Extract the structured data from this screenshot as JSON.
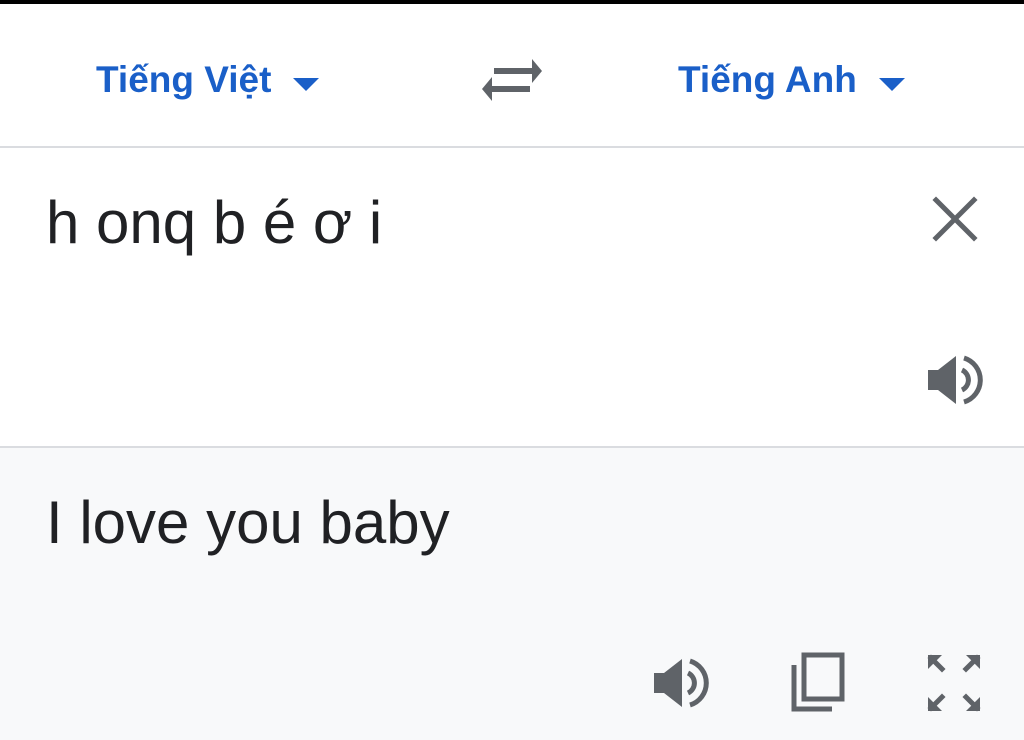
{
  "languages": {
    "source": "Tiếng Việt",
    "target": "Tiếng Anh"
  },
  "source": {
    "text": "h onq b é ơ i"
  },
  "result": {
    "text": "I love you baby"
  },
  "icons": {
    "source_caret": "caret-down-icon",
    "target_caret": "caret-down-icon",
    "swap": "swap-icon",
    "clear": "close-icon",
    "speak_source": "speaker-icon",
    "speak_result": "speaker-icon",
    "copy": "copy-icon",
    "fullscreen": "fullscreen-icon"
  },
  "colors": {
    "accent": "#1a5fc8",
    "text": "#202124",
    "icon": "#5f6368",
    "result_background": "#f8f9fa",
    "divider": "#dadce0"
  }
}
